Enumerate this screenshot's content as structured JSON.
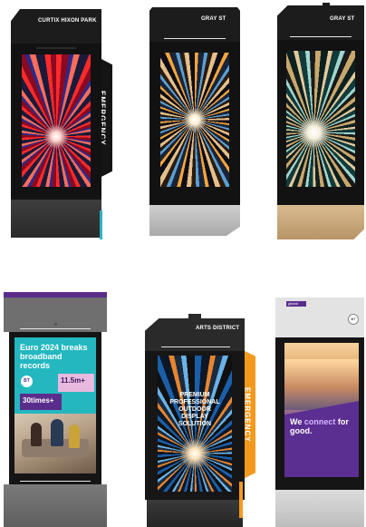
{
  "kiosks": {
    "k1": {
      "label": "CURTIX HIXON PARK",
      "side_label": "EMERGENCY"
    },
    "k2": {
      "label": "GRAY ST"
    },
    "k3": {
      "label": "GRAY ST"
    },
    "k4": {
      "ad_headline": "Euro 2024 breaks broadband records",
      "stat1_value": "11.5m+",
      "stat2_value": "30times+",
      "badge": "BT"
    },
    "k5": {
      "label": "ARTS DISTRICT",
      "side_label": "EMERGENCY",
      "ad_headline": "PREMIUM PROFESSIONAL OUTDOOR DISPLAY SOLUTION"
    },
    "k6": {
      "top_badge": "global",
      "ad_headline_plain": "We ",
      "ad_headline_accent": "connect",
      "ad_headline_tail": " for good.",
      "badge": "BT"
    }
  },
  "colors": {
    "dark_body": "#121212",
    "emergency_orange": "#f39a1e",
    "purple": "#5a2d8c",
    "teal": "#2bb5c0",
    "champagne": "#c8a87e",
    "silver": "#c9c9c9"
  }
}
